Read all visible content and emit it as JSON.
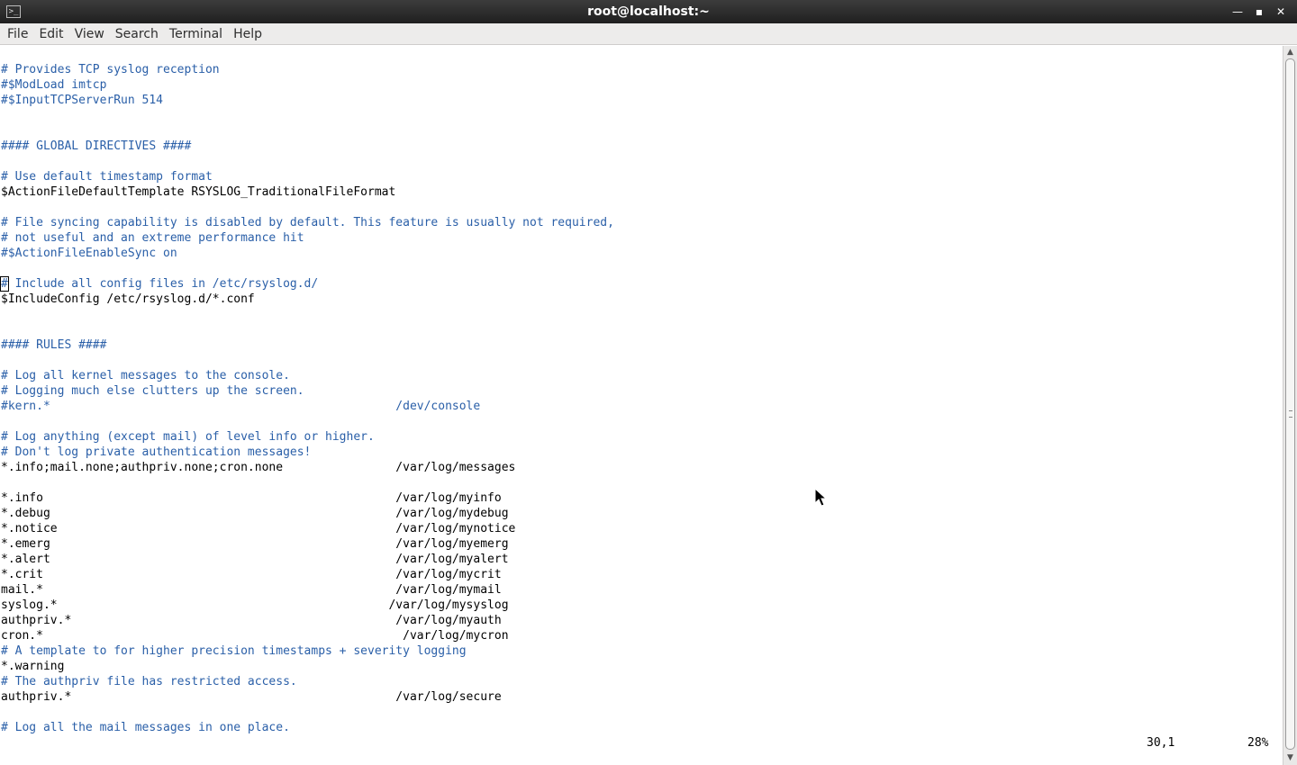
{
  "window": {
    "title": "root@localhost:~"
  },
  "menu": [
    "File",
    "Edit",
    "View",
    "Search",
    "Terminal",
    "Help"
  ],
  "lines": [
    {
      "row": 1,
      "text": "# Provides TCP syslog reception",
      "kind": "comment"
    },
    {
      "row": 2,
      "text": "#$ModLoad imtcp",
      "kind": "comment"
    },
    {
      "row": 3,
      "text": "#$InputTCPServerRun 514",
      "kind": "comment"
    },
    {
      "row": 6,
      "text": "#### GLOBAL DIRECTIVES ####",
      "kind": "comment"
    },
    {
      "row": 8,
      "text": "# Use default timestamp format",
      "kind": "comment"
    },
    {
      "row": 9,
      "text": "$ActionFileDefaultTemplate RSYSLOG_TraditionalFileFormat",
      "kind": "code"
    },
    {
      "row": 11,
      "text": "# File syncing capability is disabled by default. This feature is usually not required,",
      "kind": "comment"
    },
    {
      "row": 12,
      "text": "# not useful and an extreme performance hit",
      "kind": "comment"
    },
    {
      "row": 13,
      "text": "#$ActionFileEnableSync on",
      "kind": "comment"
    },
    {
      "row": 15,
      "text": "# Include all config files in /etc/rsyslog.d/",
      "kind": "comment",
      "cursor": true
    },
    {
      "row": 16,
      "text": "$IncludeConfig /etc/rsyslog.d/*.conf",
      "kind": "code"
    },
    {
      "row": 19,
      "text": "#### RULES ####",
      "kind": "comment"
    },
    {
      "row": 21,
      "text": "# Log all kernel messages to the console.",
      "kind": "comment"
    },
    {
      "row": 22,
      "text": "# Logging much else clutters up the screen.",
      "kind": "comment"
    },
    {
      "row": 23,
      "text": "#kern.*                                                 /dev/console",
      "kind": "comment"
    },
    {
      "row": 25,
      "text": "# Log anything (except mail) of level info or higher.",
      "kind": "comment"
    },
    {
      "row": 26,
      "text": "# Don't log private authentication messages!",
      "kind": "comment"
    },
    {
      "row": 27,
      "text": "*.info;mail.none;authpriv.none;cron.none                /var/log/messages",
      "kind": "code"
    },
    {
      "row": 29,
      "text": "*.info                                                  /var/log/myinfo",
      "kind": "code"
    },
    {
      "row": 30,
      "text": "*.debug                                                 /var/log/mydebug",
      "kind": "code"
    },
    {
      "row": 31,
      "text": "*.notice                                                /var/log/mynotice",
      "kind": "code"
    },
    {
      "row": 32,
      "text": "*.emerg                                                 /var/log/myemerg",
      "kind": "code"
    },
    {
      "row": 33,
      "text": "*.alert                                                 /var/log/myalert",
      "kind": "code"
    },
    {
      "row": 34,
      "text": "*.crit                                                  /var/log/mycrit",
      "kind": "code"
    },
    {
      "row": 35,
      "text": "mail.*                                                  /var/log/mymail",
      "kind": "code"
    },
    {
      "row": 36,
      "text": "syslog.*                                               /var/log/mysyslog",
      "kind": "code"
    },
    {
      "row": 37,
      "text": "authpriv.*                                              /var/log/myauth",
      "kind": "code"
    },
    {
      "row": 38,
      "text": "cron.*                                                   /var/log/mycron",
      "kind": "code"
    },
    {
      "row": 39,
      "text": "# A template to for higher precision timestamps + severity logging",
      "kind": "comment"
    },
    {
      "row": 40,
      "text": "*.warning",
      "kind": "code"
    },
    {
      "row": 41,
      "text": "# The authpriv file has restricted access.",
      "kind": "comment"
    },
    {
      "row": 42,
      "text": "authpriv.*                                              /var/log/secure",
      "kind": "code"
    },
    {
      "row": 44,
      "text": "# Log all the mail messages in one place.",
      "kind": "comment"
    }
  ],
  "status": {
    "position": "30,1",
    "percent": "28%"
  },
  "colors": {
    "comment": "#2a5fa8",
    "text": "#000000",
    "titlebar": "#2b2b2b",
    "menubar": "#edeceb"
  }
}
